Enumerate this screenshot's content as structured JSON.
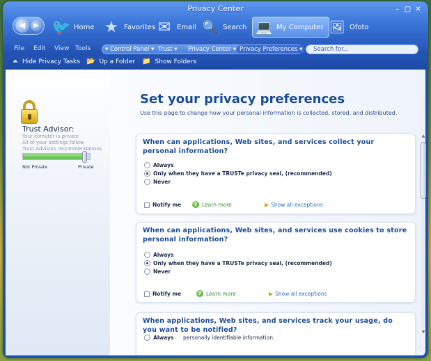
{
  "window": {
    "title": "Privacy Center"
  },
  "nav": {
    "items": [
      {
        "label": "Home",
        "icon": "home-icon"
      },
      {
        "label": "Favorites",
        "icon": "star-icon"
      },
      {
        "label": "Email",
        "icon": "envelope-icon"
      },
      {
        "label": "Search",
        "icon": "magnifier-icon"
      },
      {
        "label": "My Computer",
        "icon": "laptop-icon"
      },
      {
        "label": "Ofoto",
        "icon": "photo-icon"
      }
    ]
  },
  "menu": {
    "file": "File",
    "edit": "Edit",
    "view": "View",
    "tools": "Tools"
  },
  "breadcrumb": [
    "Control Panel",
    "Trust",
    "Privacy Center",
    "Privacy Preferences"
  ],
  "search": {
    "placeholder": "Search for..."
  },
  "tasks": {
    "hide": "Hide Privacy Tasks",
    "up": "Up a Folder",
    "show": "Show Folders"
  },
  "sidebar": {
    "title": "Trust Advisor:",
    "lines": [
      "Your comuter is private",
      "All of your settings follow",
      "Trust Advisors recommendations"
    ],
    "meter": {
      "low": "Not Private",
      "high": "Private",
      "level": 0.92
    }
  },
  "main": {
    "title": "Set your privacy preferences",
    "subtitle": "Use this page to change how your personal information is collected, stored, and distributed."
  },
  "sections": [
    {
      "question": "When can applications, Web sites, and services collect your personal information?",
      "options": [
        "Always",
        "Only when they have a TRUSTe privacy seal, (recommended)",
        "Never"
      ],
      "selected": 1,
      "notify": "Notify me",
      "learn": "Learn more",
      "exceptions": "Show all exceptions"
    },
    {
      "question": "When can applications, Web sites, and services use cookies to store personal information?",
      "options": [
        "Always",
        "Only when they have a TRUSTe privacy seal, (recommended)",
        "Never"
      ],
      "selected": 1,
      "notify": "Notify me",
      "learn": "Learn more",
      "exceptions": "Show all exceptions"
    },
    {
      "question": "When applications, Web sites, and services track your usage, do you want to be notified?",
      "options": [
        "Always"
      ],
      "extra": "personally identifiable information."
    }
  ]
}
